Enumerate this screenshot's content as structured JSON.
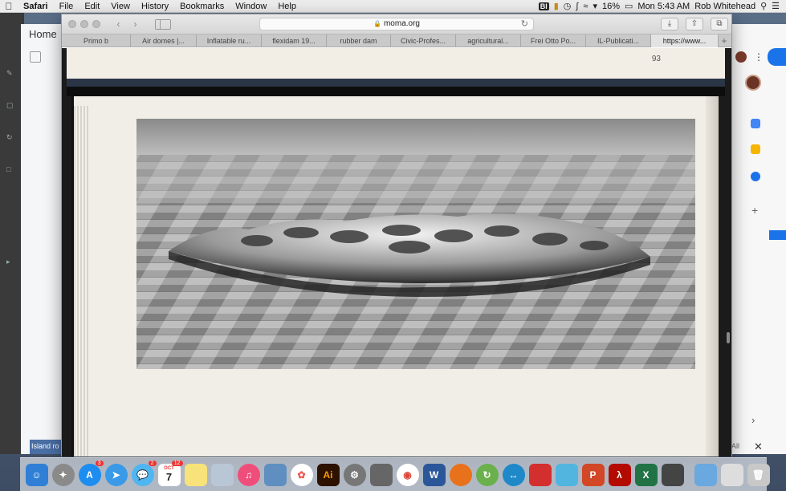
{
  "menubar": {
    "app": "Safari",
    "menus": [
      "File",
      "Edit",
      "View",
      "History",
      "Bookmarks",
      "Window",
      "Help"
    ],
    "battery": "16%",
    "clock": "Mon 5:43 AM",
    "user": "Rob Whitehead"
  },
  "bg_app": {
    "home": "Home",
    "bottom_item": "Island ro"
  },
  "bg_right": {
    "all_label": "All"
  },
  "safari": {
    "address": "moma.org",
    "tabs": [
      "Primo b",
      "Air domes |...",
      "Inflatable ru...",
      "flexidam 19...",
      "rubber dam",
      "Civic-Profes...",
      "agricultural...",
      "Frei Otto Po...",
      "IL-Publicati...",
      "https://www..."
    ]
  },
  "page": {
    "page_number": "93"
  },
  "dock": {
    "calendar_month": "OCT",
    "calendar_day": "7",
    "badge_app_store": "3",
    "badge_messages": "2",
    "badge_calendar": "12",
    "illustrator_label": "Ai"
  }
}
